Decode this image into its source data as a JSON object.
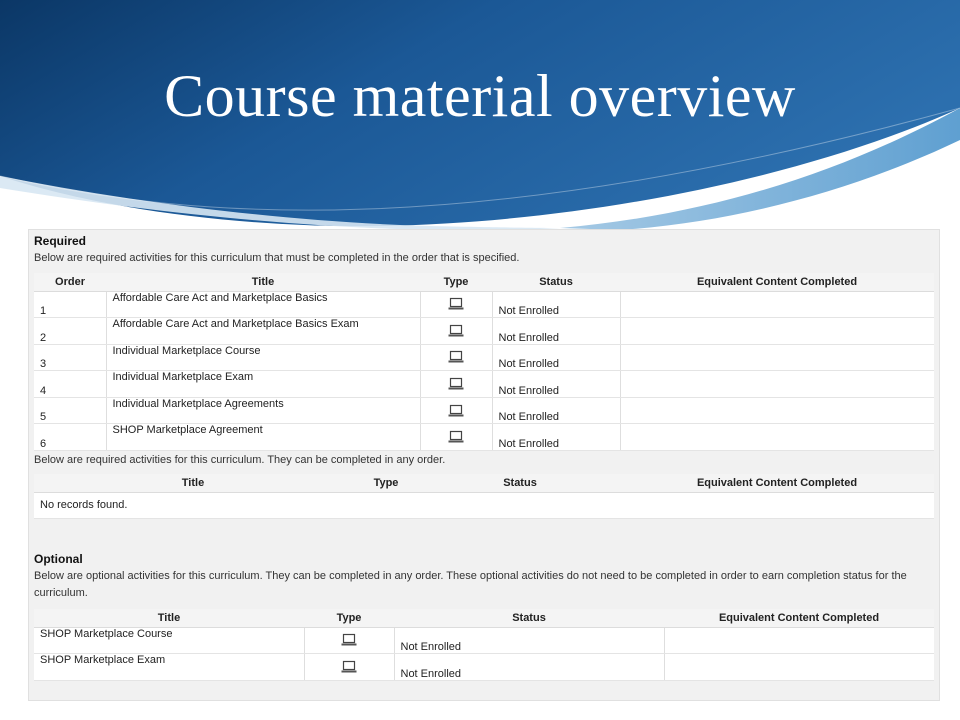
{
  "slide": {
    "title": "Course material overview"
  },
  "required": {
    "heading": "Required",
    "ordered_description": "Below are required activities for this curriculum that must be completed in the order that is specified.",
    "ordered_columns": [
      "Order",
      "Title",
      "Type",
      "Status",
      "Equivalent Content Completed"
    ],
    "ordered_rows": [
      {
        "order": "1",
        "title": "Affordable Care Act and Marketplace Basics",
        "type_icon": "laptop-icon",
        "status": "Not Enrolled",
        "equivalent": ""
      },
      {
        "order": "2",
        "title": "Affordable Care Act and Marketplace Basics Exam",
        "type_icon": "laptop-icon",
        "status": "Not Enrolled",
        "equivalent": ""
      },
      {
        "order": "3",
        "title": "Individual Marketplace Course",
        "type_icon": "laptop-icon",
        "status": "Not Enrolled",
        "equivalent": ""
      },
      {
        "order": "4",
        "title": "Individual Marketplace Exam",
        "type_icon": "laptop-icon",
        "status": "Not Enrolled",
        "equivalent": ""
      },
      {
        "order": "5",
        "title": "Individual Marketplace Agreements",
        "type_icon": "laptop-icon",
        "status": "Not Enrolled",
        "equivalent": ""
      },
      {
        "order": "6",
        "title": "SHOP Marketplace Agreement",
        "type_icon": "laptop-icon",
        "status": "Not Enrolled",
        "equivalent": ""
      }
    ],
    "any_order_description": "Below are required activities for this curriculum. They can be completed in any order.",
    "any_order_columns": [
      "Title",
      "Type",
      "Status",
      "Equivalent Content Completed"
    ],
    "any_order_empty": "No records found."
  },
  "optional": {
    "heading": "Optional",
    "description": "Below are optional activities for this curriculum. They can be completed in any order. These optional activities do not need to be completed in order to earn completion status for the curriculum.",
    "columns": [
      "Title",
      "Type",
      "Status",
      "Equivalent Content Completed"
    ],
    "rows": [
      {
        "title": "SHOP Marketplace Course",
        "type_icon": "laptop-icon",
        "status": "Not Enrolled",
        "equivalent": ""
      },
      {
        "title": "SHOP Marketplace Exam",
        "type_icon": "laptop-icon",
        "status": "Not Enrolled",
        "equivalent": ""
      }
    ]
  },
  "colors": {
    "header_dark": "#0c3a6e",
    "header_mid": "#1f5f9f",
    "header_light": "#3f8ac4",
    "panel_bg": "#f1f1f1"
  }
}
